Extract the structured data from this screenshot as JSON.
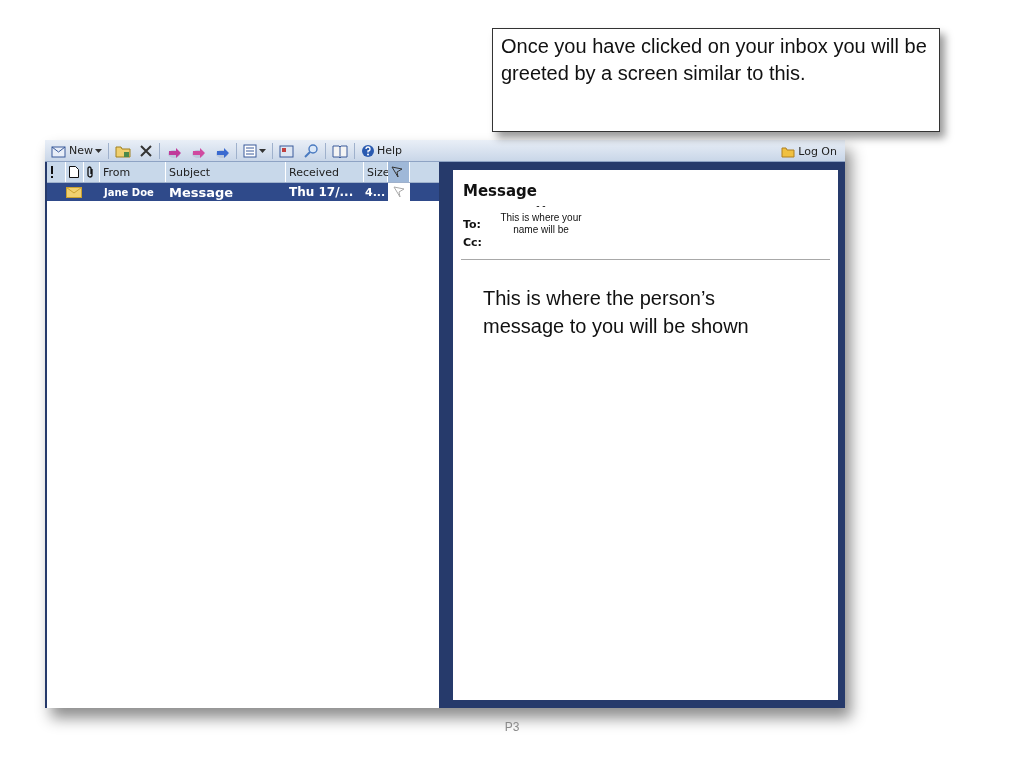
{
  "callout": {
    "text": "Once you have clicked on your inbox you will be greeted by a screen similar to this."
  },
  "toolbar": {
    "new_label": "New",
    "help_label": "Help",
    "log_on_label": "Log On"
  },
  "columns": [
    {
      "kind": "importance"
    },
    {
      "kind": "type"
    },
    {
      "kind": "attachment"
    },
    {
      "kind": "text",
      "label": "From"
    },
    {
      "kind": "text",
      "label": "Subject"
    },
    {
      "kind": "text",
      "label": "Received"
    },
    {
      "kind": "text",
      "label": "Size"
    },
    {
      "kind": "flag"
    }
  ],
  "messages": [
    {
      "from": "Jane Doe",
      "subject": "Message",
      "received": "Thu 17/...",
      "size": "4...",
      "selected": true
    }
  ],
  "reading_pane": {
    "subject": "Message",
    "dashes": "- -",
    "to_label": "To:",
    "to_value": "This is where your name will be",
    "cc_label": "Cc:",
    "body": "This is where the person’s message to you will be shown"
  },
  "footer": {
    "page": "P3"
  }
}
